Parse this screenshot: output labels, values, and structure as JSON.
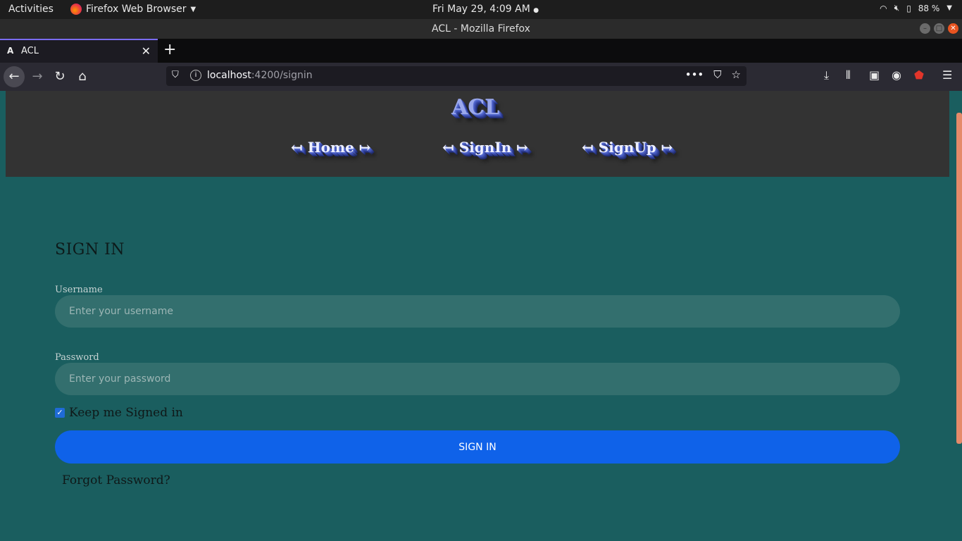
{
  "system_bar": {
    "activities": "Activities",
    "app_menu": "Firefox Web Browser",
    "clock": "Fri May 29,  4:09 AM",
    "battery": "88 %"
  },
  "window": {
    "title": "ACL - Mozilla Firefox"
  },
  "tab": {
    "favicon": "A",
    "title": "ACL"
  },
  "urlbar": {
    "host": "localhost",
    "path": ":4200/signin"
  },
  "site": {
    "logo": "ACL",
    "nav": {
      "home": "↤ Home ↦",
      "signin": "↤ SignIn ↦",
      "signup": "↤ SignUp ↦"
    }
  },
  "form": {
    "heading": "SIGN IN",
    "username_label": "Username",
    "username_placeholder": "Enter your username",
    "password_label": "Password",
    "password_placeholder": "Enter your password",
    "keep_signed_in": "Keep me Signed in",
    "keep_signed_in_checked": true,
    "submit": "SIGN IN",
    "forgot": "Forgot Password?"
  },
  "colors": {
    "page_bg": "#1a5e5f",
    "header_bg": "#333333",
    "button": "#0f62e9"
  }
}
